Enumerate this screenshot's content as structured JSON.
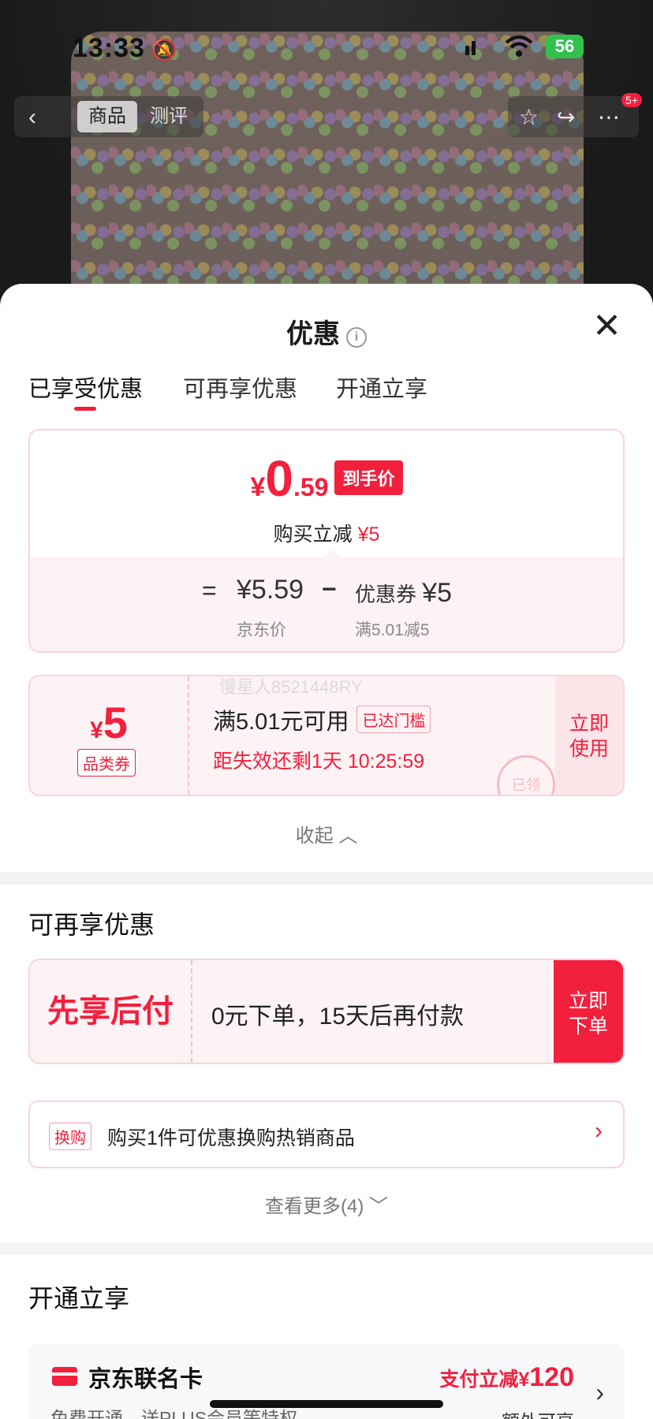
{
  "status_bar": {
    "time": "13:33",
    "battery": "56"
  },
  "top_nav": {
    "tabs": [
      "商品",
      "测评"
    ],
    "badge": "5+"
  },
  "sheet": {
    "title": "优惠",
    "tabs": [
      "已享受优惠",
      "可再享优惠",
      "开通立享"
    ],
    "price_card": {
      "yen": "¥",
      "integer": "0",
      "decimal": ".59",
      "tag": "到手价",
      "sub_label": "购买立减",
      "sub_amount": "¥5",
      "equals": "=",
      "jd_price": "¥5.59",
      "minus": "−",
      "coupon_label": "优惠券",
      "coupon_amount": "¥5",
      "jd_price_caption": "京东价",
      "coupon_caption": "满5.01减5"
    },
    "coupon": {
      "yen": "¥",
      "amount": "5",
      "category": "品类券",
      "condition": "满5.01元可用",
      "reached": "已达门槛",
      "timer": "距失效还剩1天 10:25:59",
      "use_button": "立即使用",
      "stamp": "已领",
      "watermark": "慢星人8521448RY"
    },
    "collapse": "收起",
    "section2": {
      "title": "可再享优惠",
      "paylater_label": "先享后付",
      "paylater_text": "0元下单，15天后再付款",
      "paylater_button": "立即下单",
      "swap_tag": "换购",
      "swap_text": "购买1件可优惠换购热销商品",
      "see_more": "查看更多(4)"
    },
    "section3": {
      "title": "开通立享",
      "card_name": "京东联名卡",
      "card_sub": "免费开通，送PLUS会员等特权",
      "pay_prefix": "支付立减",
      "pay_yen": "¥",
      "pay_amount": "120",
      "extra": "额外可享"
    }
  }
}
